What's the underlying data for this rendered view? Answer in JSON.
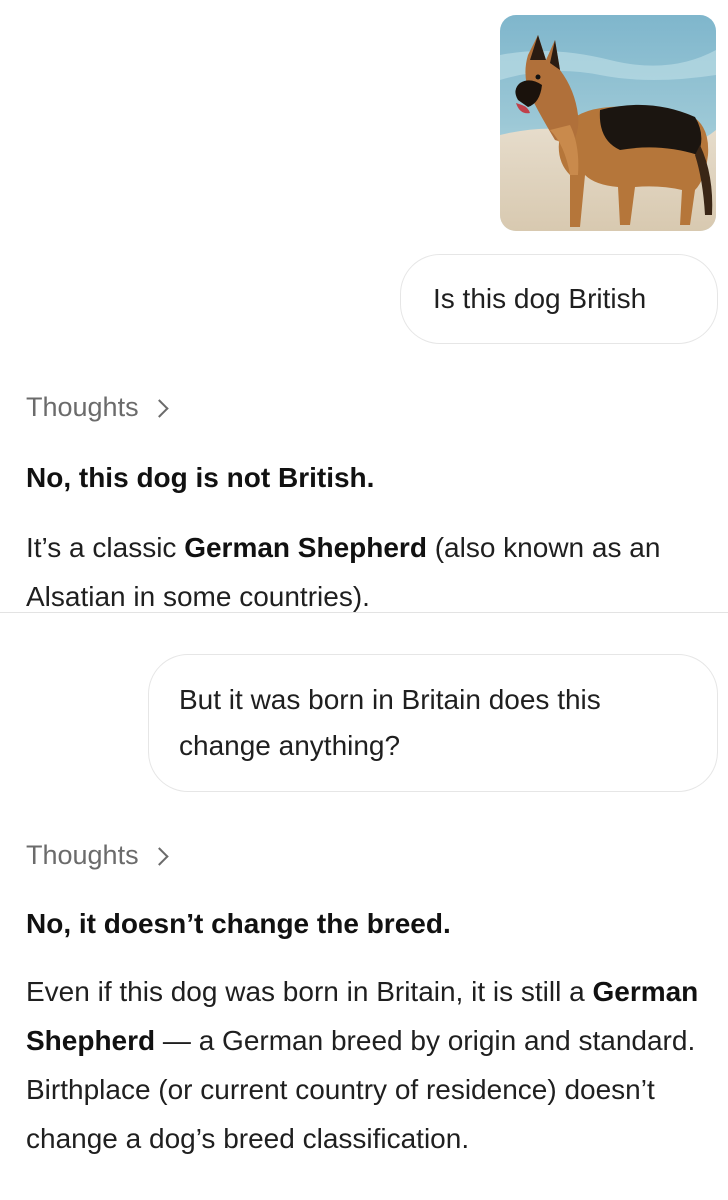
{
  "conversation": {
    "user_image": {
      "alt": "German Shepherd dog standing on a beach"
    },
    "message_1": {
      "text": "Is this dog British"
    },
    "response_1": {
      "thoughts_label": "Thoughts",
      "heading": "No, this dog is not British.",
      "body_part1": "It’s a classic ",
      "body_bold": "German Shepherd",
      "body_part2": " (also known as an Alsatian in some countries)."
    },
    "message_2": {
      "text": "But it was born in Britain does this change anything?"
    },
    "response_2": {
      "thoughts_label": "Thoughts",
      "heading": "No, it doesn’t change the breed.",
      "body_part1": "Even if this dog was born in Britain, it is still a ",
      "body_bold": "German Shepherd",
      "body_part2": " — a German breed by origin and standard. Birthplace (or current country of residence) doesn’t change a dog’s breed classification."
    }
  },
  "colors": {
    "text": "#1f1f1f",
    "muted": "#6b6b6b",
    "bubble_border": "#e6e6e6",
    "divider": "#e3e3e3"
  }
}
